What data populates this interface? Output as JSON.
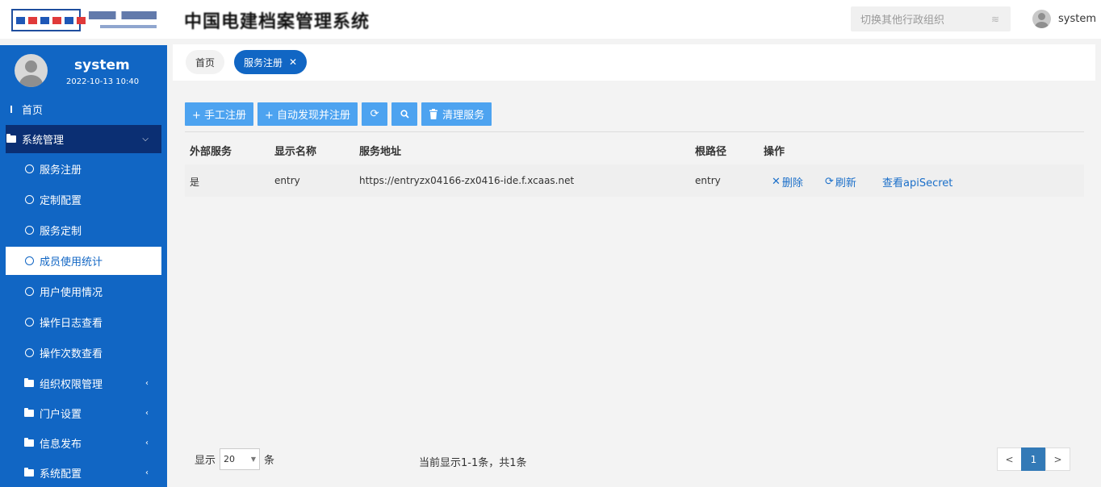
{
  "header": {
    "app_title": "中国电建档案管理系统",
    "org_switch_placeholder": "切换其他行政组织",
    "username": "system"
  },
  "sidebar": {
    "profile_name": "system",
    "profile_time": "2022-10-13 10:40",
    "items": [
      {
        "label": "首页"
      },
      {
        "label": "系统管理"
      },
      {
        "label": "服务注册"
      },
      {
        "label": "定制配置"
      },
      {
        "label": "服务定制"
      },
      {
        "label": "成员使用统计"
      },
      {
        "label": "用户使用情况"
      },
      {
        "label": "操作日志查看"
      },
      {
        "label": "操作次数查看"
      },
      {
        "label": "组织权限管理"
      },
      {
        "label": "门户设置"
      },
      {
        "label": "信息发布"
      },
      {
        "label": "系统配置"
      }
    ]
  },
  "tabs": {
    "home": "首页",
    "current": "服务注册"
  },
  "toolbar": {
    "manual_register": "+ 手工注册",
    "auto_register": "+ 自动发现并注册",
    "clean_services": "清理服务"
  },
  "table": {
    "headers": [
      "外部服务",
      "显示名称",
      "服务地址",
      "根路径",
      "操作"
    ],
    "rows": [
      {
        "external": "是",
        "display_name": "entry",
        "address": "https://entryzx04166-zx0416-ide.f.xcaas.net",
        "root_path": "entry",
        "ops": {
          "delete": "删除",
          "refresh": "刷新",
          "view_secret": "查看apiSecret"
        }
      }
    ]
  },
  "footer": {
    "show_label": "显示",
    "page_size": "20",
    "unit_label": "条",
    "page_info": "当前显示1-1条，共1条",
    "prev": "<",
    "current_page": "1",
    "next": ">"
  },
  "colors": {
    "sidebar_bg": "#1166c4",
    "sidebar_group_bg": "#0b2f73",
    "button_bg": "#4da3f0",
    "link": "#1b6fc9",
    "pager_active": "#337ab7"
  }
}
